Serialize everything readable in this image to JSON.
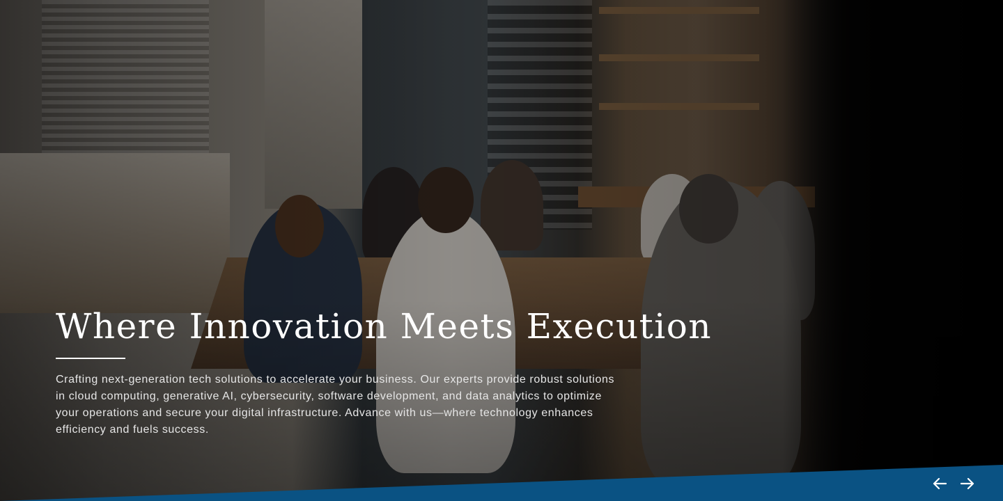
{
  "hero": {
    "title": "Where Innovation Meets Execution",
    "description": "Crafting next-generation tech solutions to accelerate your business. Our experts provide robust solutions in cloud computing, generative AI, cybersecurity, software development, and data analytics to optimize your operations and secure your digital infrastructure. Advance with us—where technology enhances efficiency and fuels success.",
    "background_image": "office-team-meeting-photo"
  },
  "band": {
    "color": "#0a5283"
  },
  "carousel": {
    "prev_icon": "arrow-left-icon",
    "next_icon": "arrow-right-icon"
  }
}
